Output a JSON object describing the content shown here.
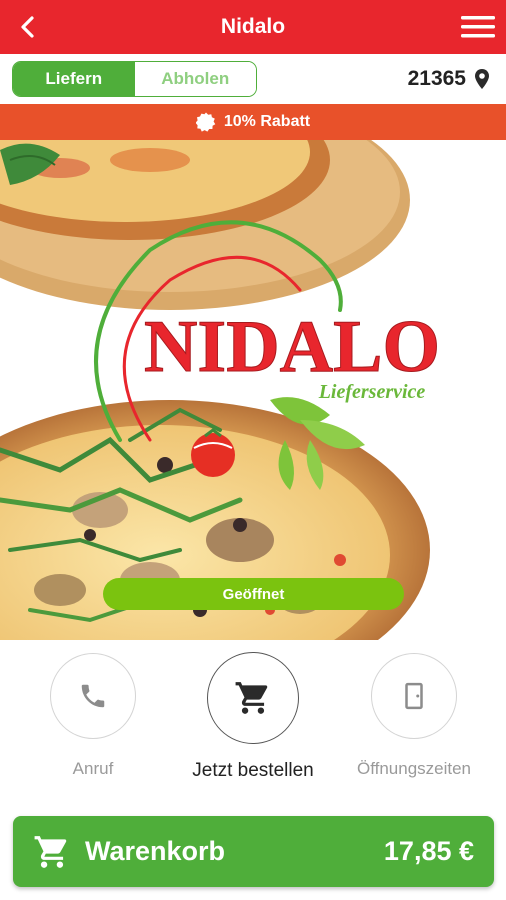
{
  "header": {
    "title": "Nidalo",
    "back_icon": "chevron-left-icon",
    "menu_icon": "hamburger-menu-icon"
  },
  "mode": {
    "options": [
      {
        "label": "Liefern",
        "active": true
      },
      {
        "label": "Abholen",
        "active": false
      }
    ],
    "zip_code": "21365",
    "zip_icon": "location-pin-icon"
  },
  "discount": {
    "icon": "badge-icon",
    "text": "10% Rabatt"
  },
  "hero": {
    "logo_text": "NIDALO",
    "logo_subtitle": "Lieferservice"
  },
  "status": {
    "label": "Geöffnet"
  },
  "actions": [
    {
      "label": "Anruf",
      "icon": "phone-icon"
    },
    {
      "label": "Jetzt bestellen",
      "icon": "shopping-cart-icon"
    },
    {
      "label": "Öffnungszeiten",
      "icon": "door-icon"
    }
  ],
  "cart": {
    "label": "Warenkorb",
    "total": "17,85 €",
    "icon": "shopping-cart-icon"
  },
  "colors": {
    "brand_red": "#e8262d",
    "discount_orange": "#e8512a",
    "green": "#4fae3a",
    "status_green": "#7bc30f"
  }
}
